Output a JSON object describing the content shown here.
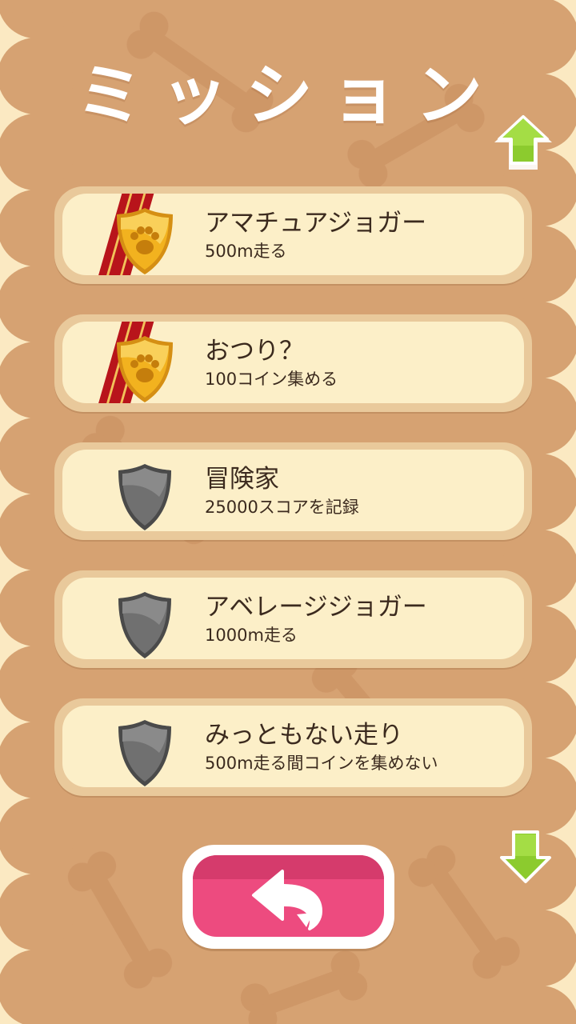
{
  "screen": {
    "title": "ミッション"
  },
  "controls": {
    "scroll_up": "up-arrow-icon",
    "scroll_down": "down-arrow-icon",
    "back": "back-arrow-icon"
  },
  "missions": [
    {
      "title": "アマチュアジョガー",
      "description": "500m走る",
      "completed": true,
      "badge": "gold-paw-shield-icon"
    },
    {
      "title": "おつり？",
      "description": "100コイン集める",
      "completed": true,
      "badge": "gold-paw-shield-icon"
    },
    {
      "title": "冒険家",
      "description": "25000スコアを記録",
      "completed": false,
      "badge": "gray-shield-icon"
    },
    {
      "title": "アベレージジョガー",
      "description": "1000m走る",
      "completed": false,
      "badge": "gray-shield-icon"
    },
    {
      "title": "みっともない走り",
      "description": "500m走る間コインを集めない",
      "completed": false,
      "badge": "gray-shield-icon"
    }
  ],
  "colors": {
    "background": "#d6a272",
    "frame": "#fbe9c2",
    "card": "#fcefc8",
    "ribbon": "#b8141b",
    "gold": "#f2b21f",
    "locked": "#6f6f6f",
    "arrow": "#8ccb2e",
    "back_button": "#ed4b7f"
  }
}
